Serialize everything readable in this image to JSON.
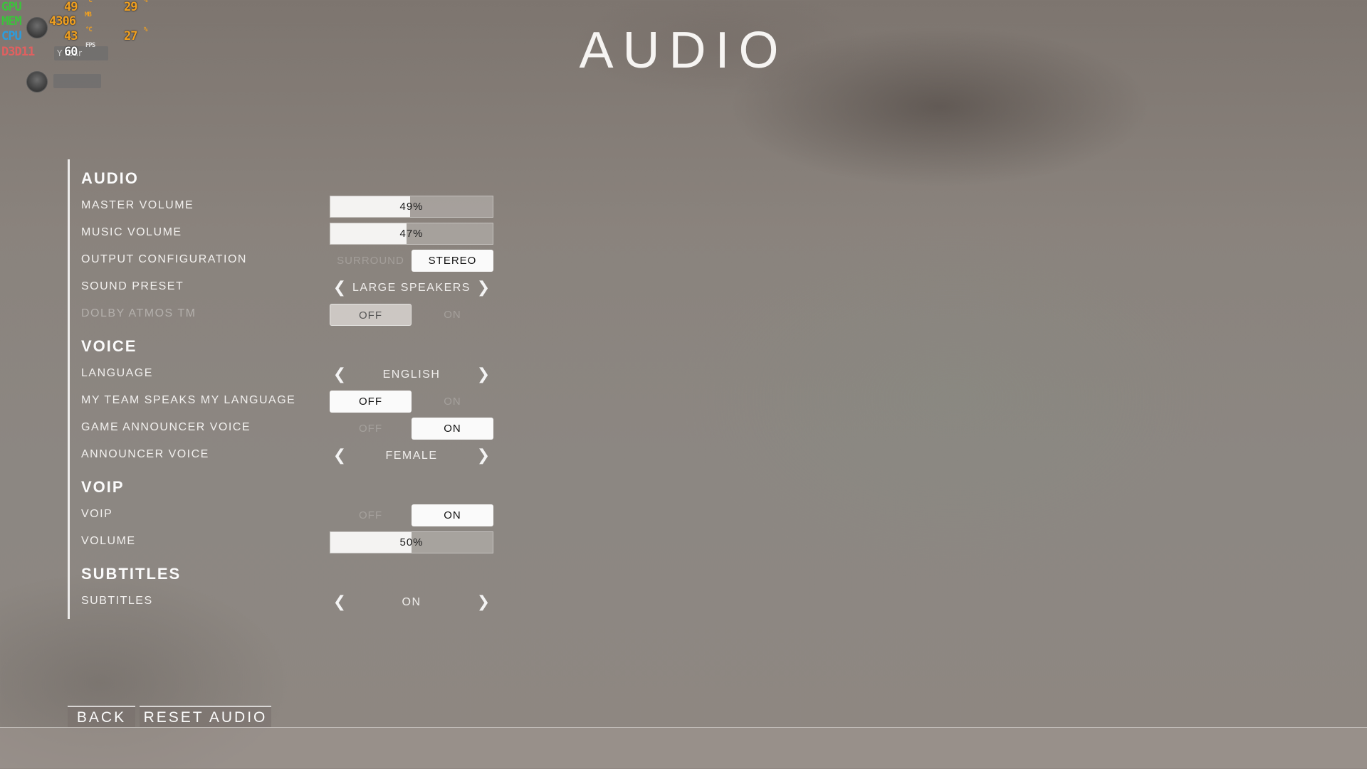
{
  "hud": {
    "gpu": {
      "label": "GPU",
      "value": "49",
      "unit": "°C",
      "value2": "29",
      "unit2": "%",
      "color": "#3cc23c"
    },
    "mem": {
      "label": "MEM",
      "value": "4306",
      "unit": "MB",
      "color": "#3cc23c"
    },
    "cpu": {
      "label": "CPU",
      "value": "43",
      "unit": "°C",
      "value2": "27",
      "unit2": "%",
      "color": "#2a9ddf"
    },
    "d3d": {
      "label": "D3D11",
      "value": "60",
      "unit": "FPS",
      "color": "#e06060"
    },
    "chip1": "Y       iBar",
    "chip2": ""
  },
  "page": {
    "title": "AUDIO"
  },
  "sections": {
    "audio": {
      "heading": "AUDIO",
      "master_volume": {
        "label": "MASTER VOLUME",
        "value_text": "49%",
        "value": 0.49
      },
      "music_volume": {
        "label": "MUSIC VOLUME",
        "value_text": "47%",
        "value": 0.47
      },
      "output_configuration": {
        "label": "OUTPUT CONFIGURATION",
        "options": [
          "SURROUND",
          "STEREO"
        ],
        "selected": "STEREO"
      },
      "sound_preset": {
        "label": "SOUND PRESET",
        "value": "LARGE SPEAKERS"
      },
      "dolby_atmos": {
        "label": "DOLBY ATMOS TM",
        "options": [
          "OFF",
          "ON"
        ],
        "selected": "OFF",
        "enabled": false
      }
    },
    "voice": {
      "heading": "VOICE",
      "language": {
        "label": "LANGUAGE",
        "value": "ENGLISH"
      },
      "team_speaks": {
        "label": "MY TEAM SPEAKS MY LANGUAGE",
        "options": [
          "OFF",
          "ON"
        ],
        "selected": "OFF"
      },
      "game_announcer": {
        "label": "GAME ANNOUNCER VOICE",
        "options": [
          "OFF",
          "ON"
        ],
        "selected": "ON"
      },
      "announcer_voice": {
        "label": "ANNOUNCER VOICE",
        "value": "FEMALE"
      }
    },
    "voip": {
      "heading": "VOIP",
      "voip": {
        "label": "VOIP",
        "options": [
          "OFF",
          "ON"
        ],
        "selected": "ON"
      },
      "volume": {
        "label": "VOLUME",
        "value_text": "50%",
        "value": 0.5
      }
    },
    "subtitles": {
      "heading": "SUBTITLES",
      "subtitles": {
        "label": "SUBTITLES",
        "value": "ON"
      }
    }
  },
  "icons": {
    "prev": "chevron-left-icon",
    "next": "chevron-right-icon"
  },
  "footer": {
    "back_label": "BACK",
    "reset_label": "RESET AUDIO"
  }
}
